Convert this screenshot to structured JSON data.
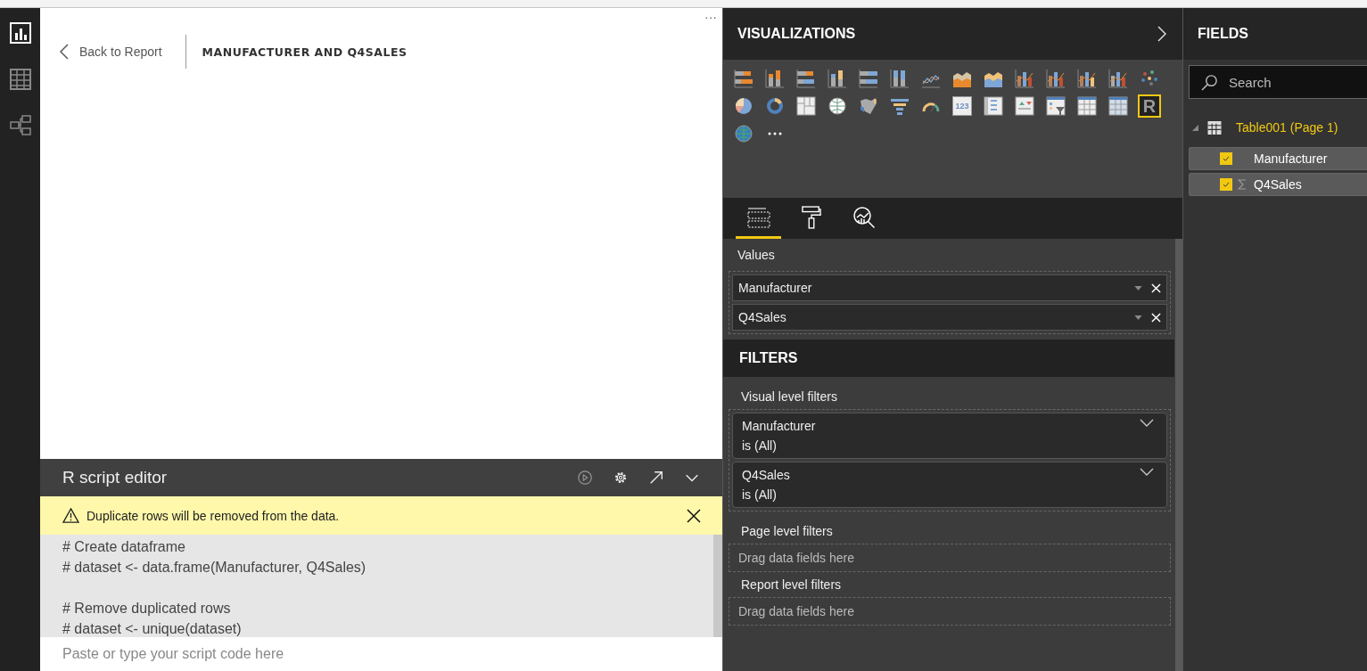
{
  "report_view": {
    "back_link": "Back to Report",
    "visual_title": "MANUFACTURER AND Q4SALES",
    "more": "···"
  },
  "script_editor": {
    "title": "R script editor",
    "warning": "Duplicate rows will be removed from the data.",
    "code_blocks": [
      [
        "# Create dataframe",
        "# dataset <- data.frame(Manufacturer, Q4Sales)"
      ],
      [
        "# Remove duplicated rows",
        "# dataset <- unique(dataset)"
      ]
    ],
    "placeholder": "Paste or type your script code here"
  },
  "visualizations": {
    "title": "VISUALIZATIONS",
    "visual_types": [
      {
        "kind": "stacked-bar",
        "selected": false
      },
      {
        "kind": "stacked-column",
        "selected": false
      },
      {
        "kind": "clustered-bar",
        "selected": false
      },
      {
        "kind": "clustered-column",
        "selected": false
      },
      {
        "kind": "full-bar",
        "selected": false
      },
      {
        "kind": "full-column",
        "selected": false
      },
      {
        "kind": "line",
        "selected": false
      },
      {
        "kind": "area",
        "selected": false
      },
      {
        "kind": "stacked-area",
        "selected": false
      },
      {
        "kind": "line-column",
        "selected": false
      },
      {
        "kind": "line-column",
        "selected": false
      },
      {
        "kind": "ribbon",
        "selected": false
      },
      {
        "kind": "waterfall",
        "selected": false
      },
      {
        "kind": "scatter",
        "selected": false
      },
      {
        "kind": "pie",
        "selected": false
      },
      {
        "kind": "donut",
        "selected": false
      },
      {
        "kind": "treemap",
        "selected": false
      },
      {
        "kind": "map",
        "selected": false
      },
      {
        "kind": "filled-map",
        "selected": false
      },
      {
        "kind": "funnel",
        "selected": false
      },
      {
        "kind": "gauge",
        "selected": false
      },
      {
        "kind": "card",
        "label": "123",
        "selected": false
      },
      {
        "kind": "multi-card",
        "selected": false
      },
      {
        "kind": "kpi",
        "selected": false
      },
      {
        "kind": "slicer",
        "selected": false
      },
      {
        "kind": "table",
        "selected": false
      },
      {
        "kind": "matrix",
        "selected": false
      },
      {
        "kind": "r-script",
        "label": "R",
        "selected": true
      },
      {
        "kind": "globe",
        "selected": false
      },
      {
        "kind": "more",
        "selected": false
      }
    ],
    "pane_tabs": [
      {
        "kind": "fields",
        "selected": true
      },
      {
        "kind": "format",
        "selected": false
      },
      {
        "kind": "analytics",
        "selected": false
      }
    ],
    "values": {
      "label": "Values",
      "items": [
        "Manufacturer",
        "Q4Sales"
      ]
    }
  },
  "filters": {
    "title": "FILTERS",
    "visual_level": {
      "label": "Visual level filters",
      "items": [
        {
          "field": "Manufacturer",
          "condition": "is (All)"
        },
        {
          "field": "Q4Sales",
          "condition": "is (All)"
        }
      ]
    },
    "page_level": {
      "label": "Page level filters",
      "placeholder": "Drag data fields here"
    },
    "report_level": {
      "label": "Report level filters",
      "placeholder": "Drag data fields here"
    }
  },
  "fields": {
    "title": "FIELDS",
    "search_placeholder": "Search",
    "table": {
      "name": "Table001 (Page 1)",
      "expanded": true,
      "children": [
        {
          "name": "Manufacturer",
          "kind": "text",
          "checked": true
        },
        {
          "name": "Q4Sales",
          "kind": "sum",
          "checked": true
        }
      ]
    }
  }
}
